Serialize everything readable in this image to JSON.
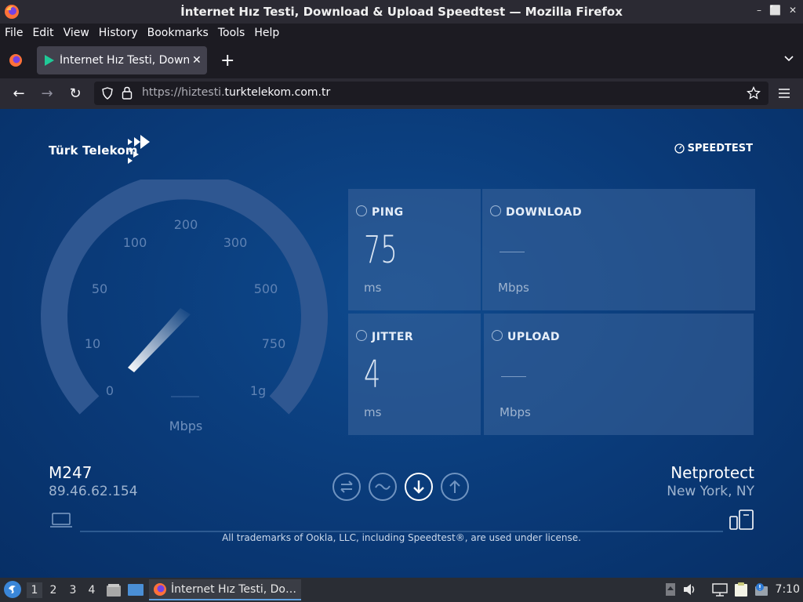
{
  "window": {
    "title": "İnternet Hız Testi, Download & Upload Speedtest — Mozilla Firefox",
    "controls": [
      "–",
      "⬜",
      "✕"
    ]
  },
  "menubar": {
    "items": [
      "File",
      "Edit",
      "View",
      "History",
      "Bookmarks",
      "Tools",
      "Help"
    ]
  },
  "tabs": [
    {
      "label": "İnternet Hız Testi, Downlo",
      "close": "✕"
    }
  ],
  "navbar": {
    "url_prefix": "https://hiztesti.",
    "url_domain": "turktelekom.com.tr"
  },
  "page": {
    "brand": "Türk Telekom",
    "speedtest_link": "SPEEDTEST",
    "gauge": {
      "ticks": [
        "0",
        "10",
        "50",
        "100",
        "200",
        "300",
        "500",
        "750",
        "1g"
      ],
      "unit": "Mbps"
    },
    "metrics": {
      "ping": {
        "label": "PING",
        "value": "75",
        "unit": "ms"
      },
      "download": {
        "label": "DOWNLOAD",
        "value": "",
        "unit": "Mbps"
      },
      "jitter": {
        "label": "JITTER",
        "value": "4",
        "unit": "ms"
      },
      "upload": {
        "label": "UPLOAD",
        "value": "",
        "unit": "Mbps"
      }
    },
    "client": {
      "isp": "M247",
      "ip": "89.46.62.154"
    },
    "server": {
      "host": "Netprotect",
      "location": "New York, NY"
    },
    "modes": [
      "multi",
      "single",
      "download",
      "upload"
    ],
    "active_mode": "download",
    "trademark": "All trademarks of Ookla, LLC, including Speedtest®, are used under license."
  },
  "taskbar": {
    "workspaces": [
      "1",
      "2",
      "3",
      "4"
    ],
    "active_workspace": "1",
    "task_title": "İnternet Hız Testi, Do…",
    "clock": "7:10"
  },
  "colors": {
    "page_bg": "#0a3a78",
    "tile_bg": "#3c649b",
    "accent": "#20c997"
  }
}
